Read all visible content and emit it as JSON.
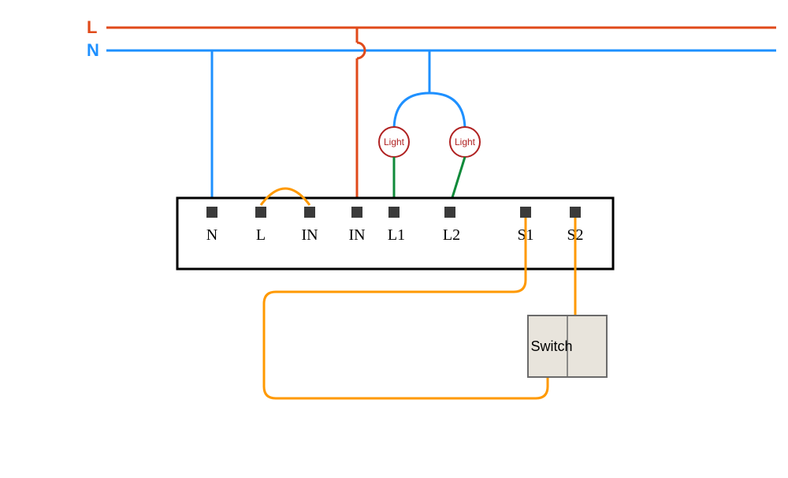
{
  "colors": {
    "live": "#e04a1a",
    "neutral": "#1e90ff",
    "switchWire": "#ff9900",
    "loadWire": "#0f8a3a",
    "boxStroke": "#000000",
    "terminalFill": "#3a3a3a",
    "switchFill": "#e8e4dc",
    "switchStroke": "#6b6b6b",
    "lightStroke": "#b02222"
  },
  "bus": {
    "live": "L",
    "neutral": "N"
  },
  "terminals": [
    "N",
    "L",
    "IN",
    "IN",
    "L1",
    "L2",
    "S1",
    "S2"
  ],
  "terminalLabelColors": [
    "#1e90ff",
    "#e04a1a",
    "#000000",
    "#000000",
    "#000000",
    "#000000",
    "#000000",
    "#000000"
  ],
  "lights": {
    "left": "Light",
    "right": "Light"
  },
  "switch": {
    "label": "Switch"
  }
}
